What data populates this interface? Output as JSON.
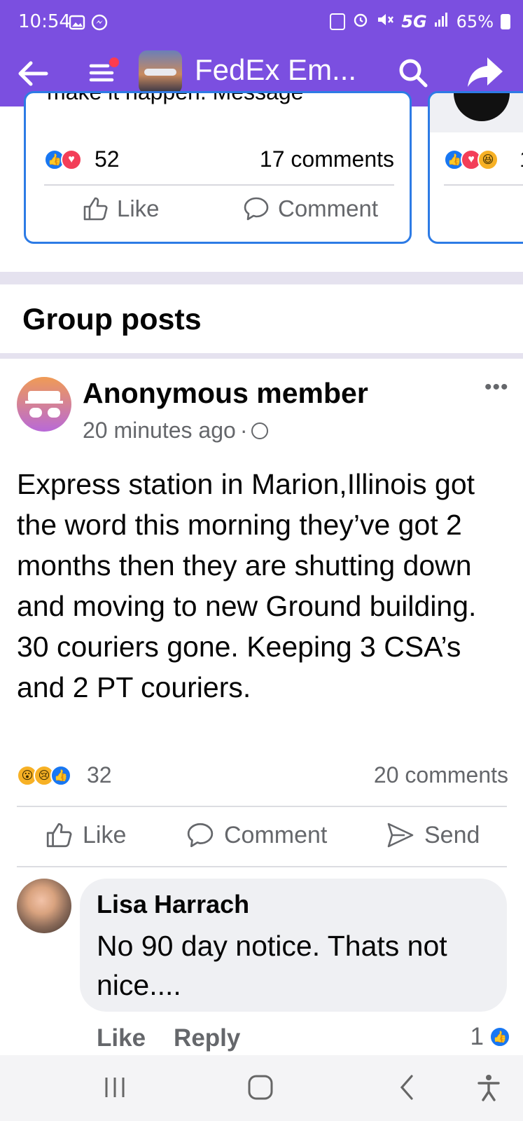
{
  "status_bar": {
    "time": "10:54",
    "network": "5G",
    "battery": "65%"
  },
  "app_bar": {
    "title": "FedEx Em...",
    "colors": {
      "bar": "#7b4fe0",
      "notification_dot": "#ff3b4e"
    }
  },
  "featured_card": {
    "clipped_text": "make it happen. Message",
    "reaction_count": "52",
    "comments": "17 comments",
    "like_label": "Like",
    "comment_label": "Comment"
  },
  "featured_card_2": {
    "reaction_count": "1"
  },
  "section": {
    "title": "Group posts"
  },
  "post": {
    "author": "Anonymous member",
    "time": "20 minutes ago",
    "time_separator": "·",
    "body": "Express station in Marion,Illinois got the word this morning they’ve got 2 months then they are shutting down and moving to new Ground building. 30 couriers gone. Keeping 3 CSA’s and 2 PT couriers.",
    "reaction_count": "32",
    "comments": "20 comments",
    "actions": {
      "like": "Like",
      "comment": "Comment",
      "send": "Send"
    }
  },
  "comment": {
    "author": "Lisa Harrach",
    "text": "No 90 day notice. Thats not nice....",
    "like_label": "Like",
    "reply_label": "Reply",
    "like_count": "1"
  }
}
